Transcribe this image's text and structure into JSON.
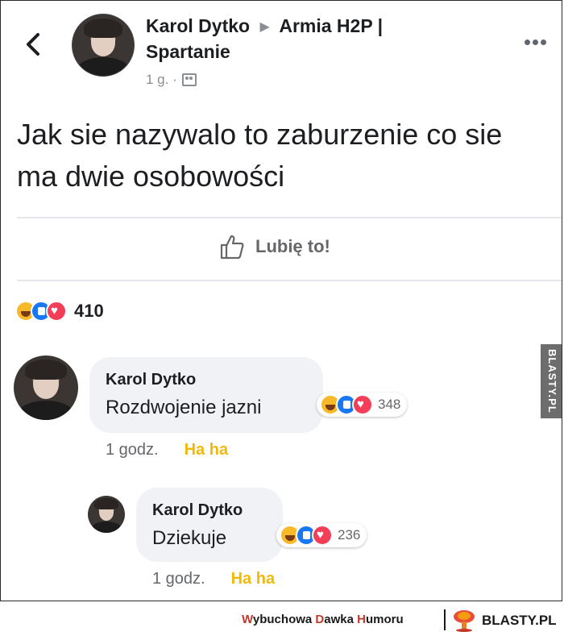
{
  "post": {
    "author": "Karol Dytko",
    "group_line1": "Armia H2P |",
    "group_line2": "Spartanie",
    "time": "1 g. ·",
    "text": "Jak sie nazywalo to zaburzenie co sie ma dwie osobowości"
  },
  "actions": {
    "like_label": "Lubię to!"
  },
  "reactions": {
    "count": "410",
    "types": [
      "haha",
      "like",
      "love"
    ]
  },
  "comments": [
    {
      "author": "Karol Dytko",
      "text": "Rozdwojenie jazni",
      "reaction_count": "348",
      "time": "1 godz.",
      "haha_label": "Ha ha"
    },
    {
      "author": "Karol Dytko",
      "text": "Dziekuje",
      "reaction_count": "236",
      "time": "1 godz.",
      "haha_label": "Ha ha"
    }
  ],
  "watermark": {
    "side": "BLASTY.PL",
    "footer_w": "W",
    "footer_ybuchowa": "ybuchowa ",
    "footer_d": "D",
    "footer_awka": "awka ",
    "footer_h": "H",
    "footer_umoru": "umoru",
    "footer_brand": "BLASTY.PL"
  },
  "colors": {
    "like_blue": "#1877f2",
    "haha_yellow": "#f7b928",
    "love_red": "#f33e58",
    "haha_text": "#f0b90b"
  },
  "icons": {
    "back": "chevron-left-icon",
    "more": "more-horizontal-icon",
    "group": "group-icon",
    "like": "thumbs-up-icon"
  }
}
